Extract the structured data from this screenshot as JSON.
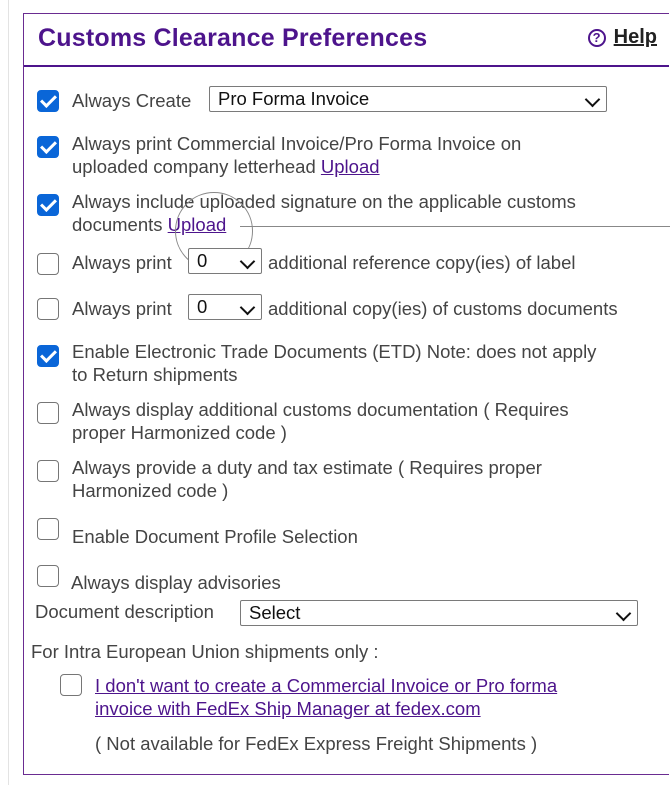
{
  "header": {
    "title": "Customs Clearance Preferences",
    "help_label": "Help",
    "help_icon": "question-circle-icon"
  },
  "options": {
    "always_create": {
      "checked": true,
      "label": "Always Create",
      "selected": "Pro Forma Invoice"
    },
    "print_letterhead": {
      "checked": true,
      "label_line1": "Always print Commercial Invoice/Pro Forma Invoice on",
      "label_line2": "uploaded company letterhead",
      "link": "Upload"
    },
    "include_signature": {
      "checked": true,
      "label_line1": "Always include uploaded signature on the applicable customs",
      "label_line2": "documents",
      "link": "Upload"
    },
    "reference_copies": {
      "checked": false,
      "label_before": "Always print",
      "selected": "0",
      "label_after": "additional reference copy(ies) of label"
    },
    "customs_copies": {
      "checked": false,
      "label_before": "Always print",
      "selected": "0",
      "label_after": "additional copy(ies) of customs documents"
    },
    "etd": {
      "checked": true,
      "label_line1": "Enable Electronic Trade Documents (ETD) Note: does not apply",
      "label_line2": "to Return shipments"
    },
    "additional_docs": {
      "checked": false,
      "label_line1": "Always display additional customs documentation ( Requires",
      "label_line2": "proper Harmonized code )"
    },
    "duty_tax": {
      "checked": false,
      "label_line1": "Always provide a duty and tax estimate ( Requires proper",
      "label_line2": "Harmonized code )"
    },
    "doc_profile": {
      "checked": false,
      "label": "Enable Document Profile Selection"
    },
    "advisories": {
      "checked": false,
      "label": "Always display advisories"
    }
  },
  "document_description": {
    "label": "Document description",
    "selected": "Select"
  },
  "eu": {
    "heading": "For Intra European Union shipments only :",
    "checked": false,
    "link_line1": "I don't want to create a Commercial Invoice or Pro forma",
    "link_line2": "invoice with FedEx Ship Manager at fedex.com",
    "note": "( Not available for FedEx Express Freight Shipments )"
  },
  "colors": {
    "brand_purple": "#4d148c",
    "checkbox_blue": "#0a66d8"
  }
}
